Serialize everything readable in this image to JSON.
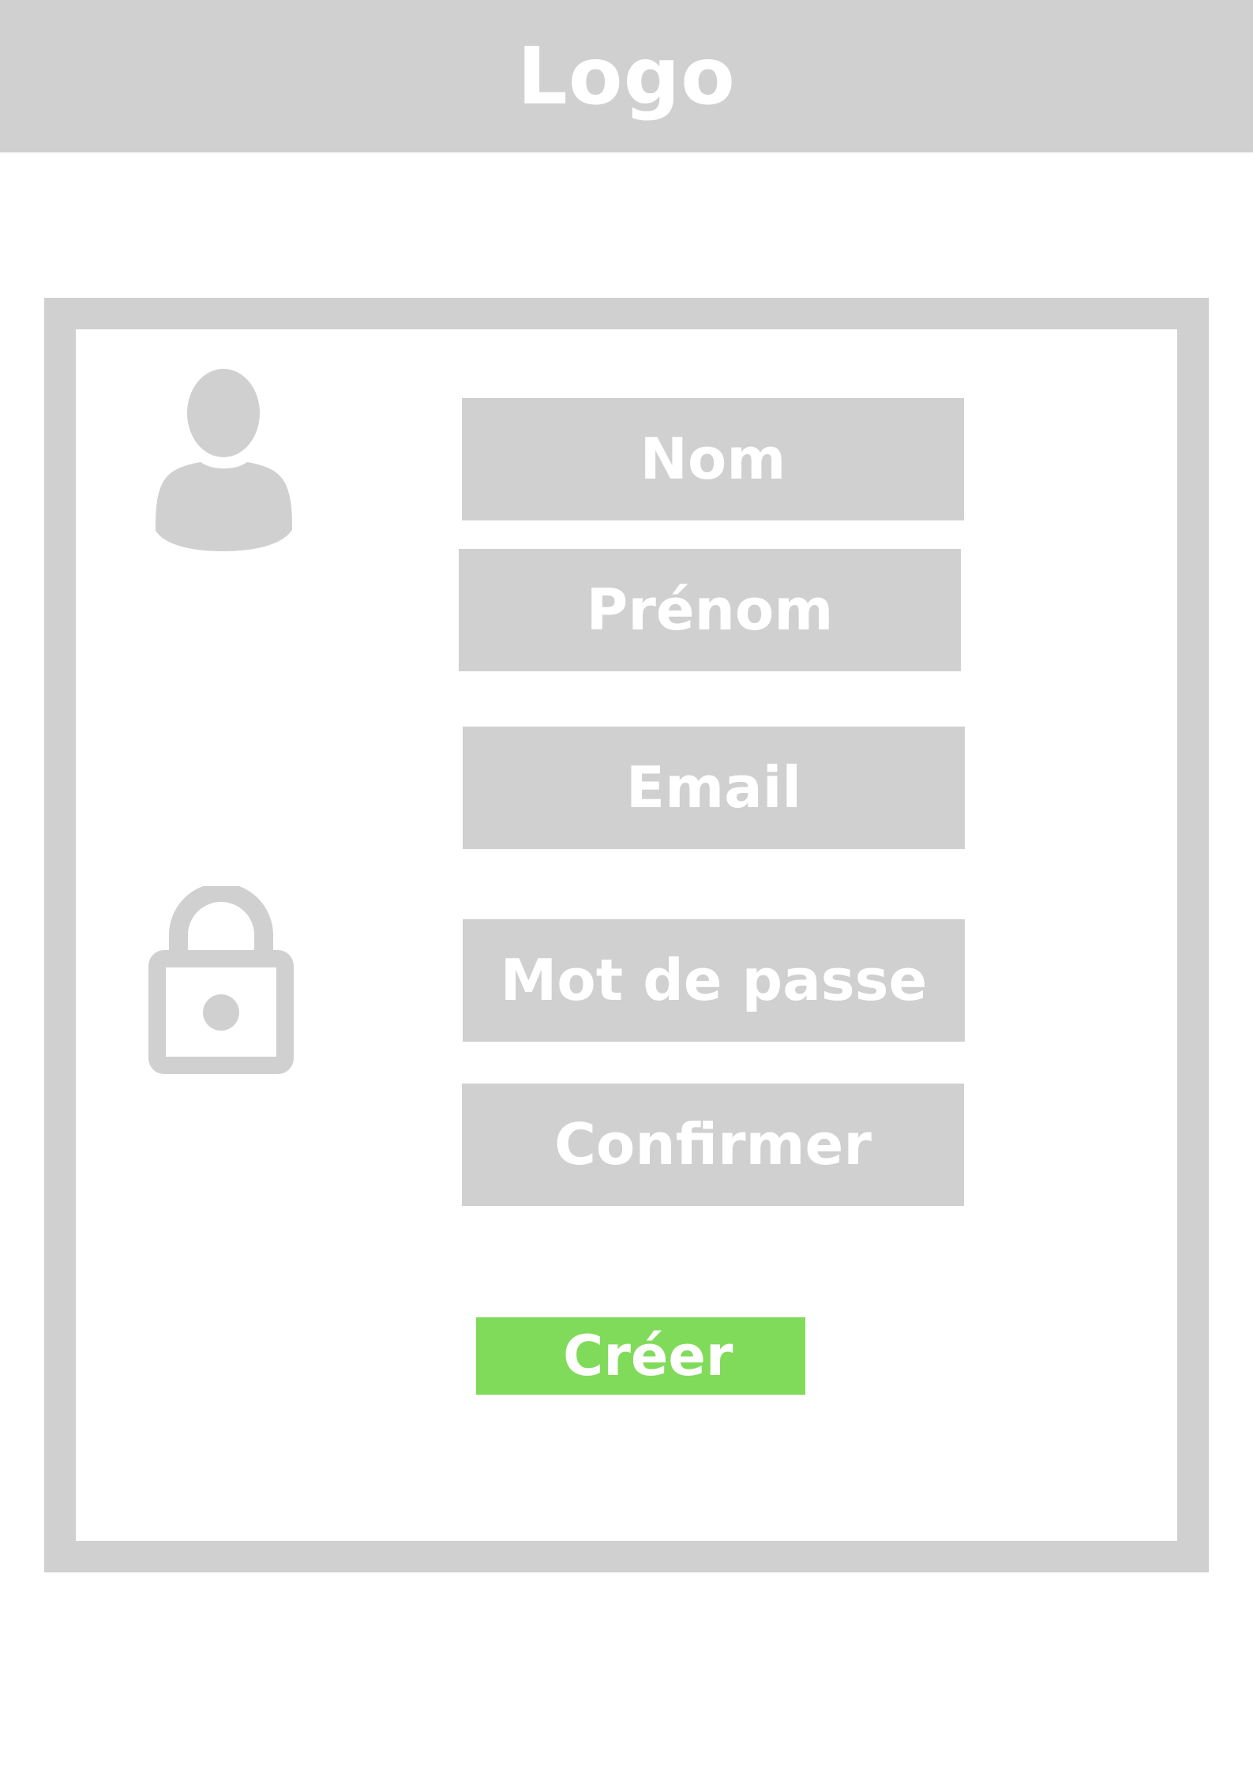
{
  "header": {
    "logo_text": "Logo"
  },
  "form": {
    "icons": {
      "user": "user-icon",
      "password": "lock-icon"
    },
    "fields": {
      "nom": "Nom",
      "prenom": "Prénom",
      "email": "Email",
      "mot_de_passe": "Mot de passe",
      "confirmer": "Confirmer"
    },
    "submit_label": "Créer"
  },
  "colors": {
    "gray": "#d0d0d0",
    "submit": "#80db5a",
    "text": "#ffffff"
  }
}
